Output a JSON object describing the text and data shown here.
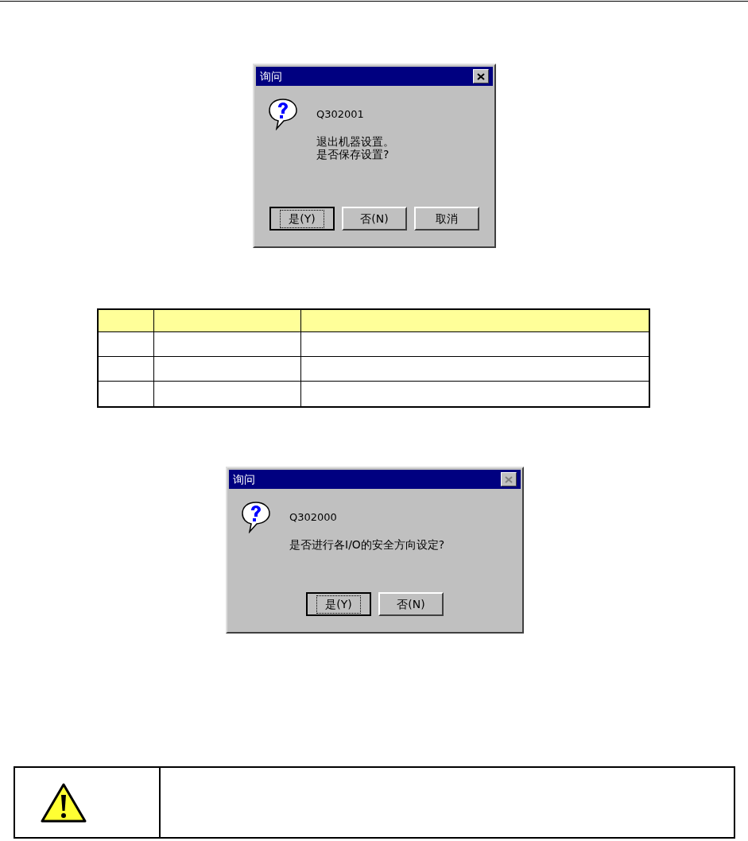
{
  "dialogs": [
    {
      "title": "询问",
      "close_enabled": true,
      "code": "Q302001",
      "message_lines": [
        "退出机器设置。",
        "是否保存设置?"
      ],
      "buttons": [
        {
          "label": "是(Y)",
          "default": true
        },
        {
          "label": "否(N)",
          "default": false
        },
        {
          "label": "取消",
          "default": false
        }
      ]
    },
    {
      "title": "询问",
      "close_enabled": false,
      "code": "Q302000",
      "message_lines": [
        "是否进行各I/O的安全方向设定?"
      ],
      "buttons": [
        {
          "label": "是(Y)",
          "default": true
        },
        {
          "label": "否(N)",
          "default": false
        }
      ]
    }
  ],
  "warning": {
    "kind": "caution"
  }
}
